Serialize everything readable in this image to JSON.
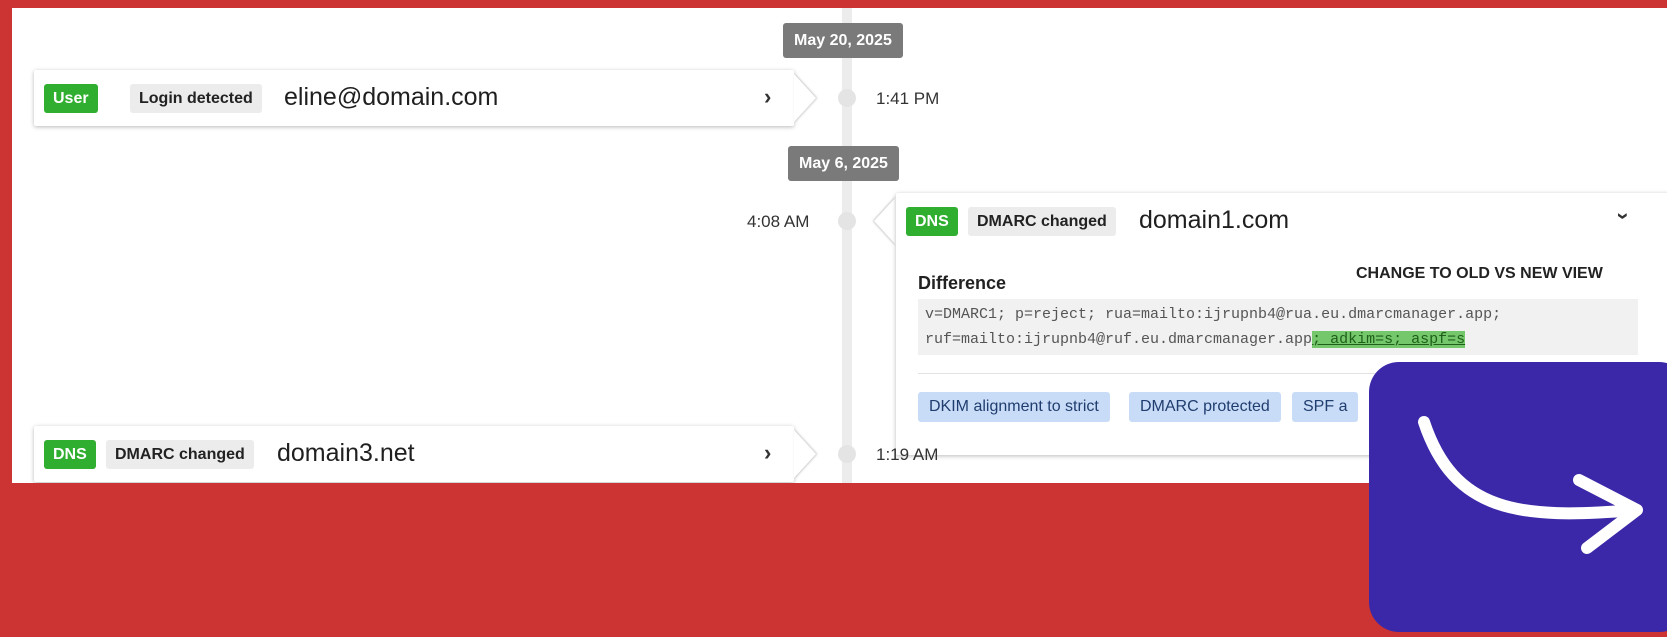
{
  "timeline": {
    "date_1": "May 20, 2025",
    "date_2": "May 6, 2025"
  },
  "events": {
    "login": {
      "tag": "User",
      "type": "Login detected",
      "subject": "eline@domain.com",
      "time": "1:41 PM"
    },
    "dmarc1": {
      "tag": "DNS",
      "type": "DMARC changed",
      "subject": "domain1.com",
      "time": "4:08 AM",
      "difference_label": "Difference",
      "view_toggle": "CHANGE TO OLD VS NEW VIEW",
      "diff_line1": "v=DMARC1; p=reject; rua=mailto:ijrupnb4@rua.eu.dmarcmanager.app;",
      "diff_line2_plain": "ruf=mailto:ijrupnb4@ruf.eu.dmarcmanager.app",
      "diff_line2_added": "; adkim=s; aspf=s",
      "chips": [
        "DKIM alignment to strict",
        "DMARC protected",
        "SPF a"
      ]
    },
    "dmarc3": {
      "tag": "DNS",
      "type": "DMARC changed",
      "subject": "domain3.net",
      "time": "1:19 AM"
    }
  },
  "colors": {
    "frame": "#cc3333",
    "tag_green": "#2fae2f",
    "promo": "#3a28a8",
    "diff_added": "#74c76a",
    "chip": "#c9dcf7"
  },
  "icons": {
    "expand": "chevron-right-icon",
    "collapse": "chevron-down-icon",
    "promo_arrow": "curved-arrow-icon"
  }
}
